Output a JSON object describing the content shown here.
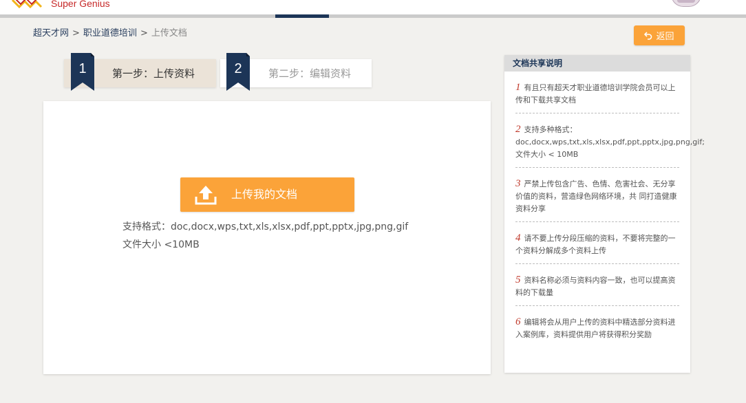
{
  "header": {
    "brand": "Super Genius"
  },
  "breadcrumb": {
    "items": [
      "超天才网",
      "职业道德培训"
    ],
    "separator": ">",
    "current": "上传文档"
  },
  "back_button": {
    "label": "返回"
  },
  "steps": [
    {
      "number": "1",
      "label": "第一步：上传资料"
    },
    {
      "number": "2",
      "label": "第二步：编辑资料"
    }
  ],
  "upload": {
    "button_label": "上传我的文档",
    "formats_text": "支持格式：doc,docx,wps,txt,xls,xlsx,pdf,ppt,pptx,jpg,png,gif",
    "size_text": "文件大小  <10MB"
  },
  "sidebar": {
    "title": "文档共享说明",
    "notes": [
      {
        "num": "1",
        "text": "有且只有超天才职业道德培训学院会员可以上传和下载共享文档"
      },
      {
        "num": "2",
        "text": "支持多种格式：doc,docx,wps,txt,xls,xlsx,pdf,ppt,pptx,jpg,png,gif; 文件大小 < 10MB"
      },
      {
        "num": "3",
        "text": "严禁上传包含广告、色情、危害社会、无分享价值的资料，营造绿色网络环境，共 同打造健康资料分享"
      },
      {
        "num": "4",
        "text": "请不要上传分段压缩的资料，不要将完整的一个资料分解成多个资料上传"
      },
      {
        "num": "5",
        "text": "资料名称必须与资料内容一致，也可以提高资料的下载量"
      },
      {
        "num": "6",
        "text": "编辑将会从用户上传的资料中精选部分资料进入案例库，资料提供用户将获得积分奖励"
      }
    ]
  },
  "colors": {
    "accent_orange": "#fba339",
    "navy": "#1c3557",
    "note_number_red": "#c0392b",
    "step_active_bg": "#ebe3d8"
  },
  "icons": {
    "logo": "super-genius-logo",
    "back": "return-arrow-icon",
    "upload": "upload-arrow-icon",
    "avatar": "user-avatar"
  }
}
